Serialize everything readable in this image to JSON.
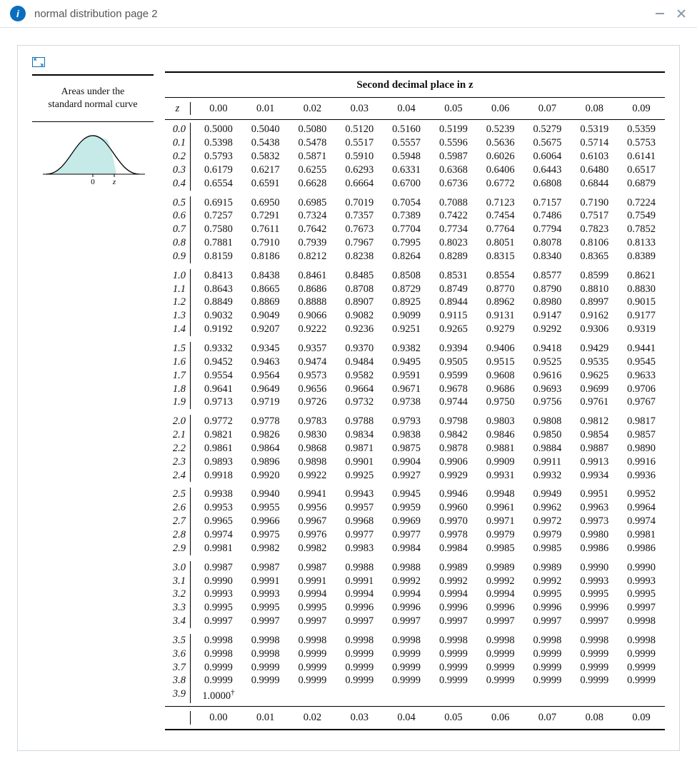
{
  "header": {
    "title": "normal distribution page 2"
  },
  "panel": {
    "side_label_line1": "Areas under the",
    "side_label_line2": "standard normal curve",
    "table_title": "Second decimal place in z",
    "z_header": "z"
  },
  "chart_data": {
    "type": "table",
    "title": "Areas under the standard normal curve — Second decimal place in z",
    "columns": [
      "0.00",
      "0.01",
      "0.02",
      "0.03",
      "0.04",
      "0.05",
      "0.06",
      "0.07",
      "0.08",
      "0.09"
    ],
    "footer_columns": [
      "0.00",
      "0.01",
      "0.02",
      "0.03",
      "0.04",
      "0.05",
      "0.06",
      "0.07",
      "0.08",
      "0.09"
    ],
    "row_groups": [
      [
        {
          "z": "0.0",
          "v": [
            "0.5000",
            "0.5040",
            "0.5080",
            "0.5120",
            "0.5160",
            "0.5199",
            "0.5239",
            "0.5279",
            "0.5319",
            "0.5359"
          ]
        },
        {
          "z": "0.1",
          "v": [
            "0.5398",
            "0.5438",
            "0.5478",
            "0.5517",
            "0.5557",
            "0.5596",
            "0.5636",
            "0.5675",
            "0.5714",
            "0.5753"
          ]
        },
        {
          "z": "0.2",
          "v": [
            "0.5793",
            "0.5832",
            "0.5871",
            "0.5910",
            "0.5948",
            "0.5987",
            "0.6026",
            "0.6064",
            "0.6103",
            "0.6141"
          ]
        },
        {
          "z": "0.3",
          "v": [
            "0.6179",
            "0.6217",
            "0.6255",
            "0.6293",
            "0.6331",
            "0.6368",
            "0.6406",
            "0.6443",
            "0.6480",
            "0.6517"
          ]
        },
        {
          "z": "0.4",
          "v": [
            "0.6554",
            "0.6591",
            "0.6628",
            "0.6664",
            "0.6700",
            "0.6736",
            "0.6772",
            "0.6808",
            "0.6844",
            "0.6879"
          ]
        }
      ],
      [
        {
          "z": "0.5",
          "v": [
            "0.6915",
            "0.6950",
            "0.6985",
            "0.7019",
            "0.7054",
            "0.7088",
            "0.7123",
            "0.7157",
            "0.7190",
            "0.7224"
          ]
        },
        {
          "z": "0.6",
          "v": [
            "0.7257",
            "0.7291",
            "0.7324",
            "0.7357",
            "0.7389",
            "0.7422",
            "0.7454",
            "0.7486",
            "0.7517",
            "0.7549"
          ]
        },
        {
          "z": "0.7",
          "v": [
            "0.7580",
            "0.7611",
            "0.7642",
            "0.7673",
            "0.7704",
            "0.7734",
            "0.7764",
            "0.7794",
            "0.7823",
            "0.7852"
          ]
        },
        {
          "z": "0.8",
          "v": [
            "0.7881",
            "0.7910",
            "0.7939",
            "0.7967",
            "0.7995",
            "0.8023",
            "0.8051",
            "0.8078",
            "0.8106",
            "0.8133"
          ]
        },
        {
          "z": "0.9",
          "v": [
            "0.8159",
            "0.8186",
            "0.8212",
            "0.8238",
            "0.8264",
            "0.8289",
            "0.8315",
            "0.8340",
            "0.8365",
            "0.8389"
          ]
        }
      ],
      [
        {
          "z": "1.0",
          "v": [
            "0.8413",
            "0.8438",
            "0.8461",
            "0.8485",
            "0.8508",
            "0.8531",
            "0.8554",
            "0.8577",
            "0.8599",
            "0.8621"
          ]
        },
        {
          "z": "1.1",
          "v": [
            "0.8643",
            "0.8665",
            "0.8686",
            "0.8708",
            "0.8729",
            "0.8749",
            "0.8770",
            "0.8790",
            "0.8810",
            "0.8830"
          ]
        },
        {
          "z": "1.2",
          "v": [
            "0.8849",
            "0.8869",
            "0.8888",
            "0.8907",
            "0.8925",
            "0.8944",
            "0.8962",
            "0.8980",
            "0.8997",
            "0.9015"
          ]
        },
        {
          "z": "1.3",
          "v": [
            "0.9032",
            "0.9049",
            "0.9066",
            "0.9082",
            "0.9099",
            "0.9115",
            "0.9131",
            "0.9147",
            "0.9162",
            "0.9177"
          ]
        },
        {
          "z": "1.4",
          "v": [
            "0.9192",
            "0.9207",
            "0.9222",
            "0.9236",
            "0.9251",
            "0.9265",
            "0.9279",
            "0.9292",
            "0.9306",
            "0.9319"
          ]
        }
      ],
      [
        {
          "z": "1.5",
          "v": [
            "0.9332",
            "0.9345",
            "0.9357",
            "0.9370",
            "0.9382",
            "0.9394",
            "0.9406",
            "0.9418",
            "0.9429",
            "0.9441"
          ]
        },
        {
          "z": "1.6",
          "v": [
            "0.9452",
            "0.9463",
            "0.9474",
            "0.9484",
            "0.9495",
            "0.9505",
            "0.9515",
            "0.9525",
            "0.9535",
            "0.9545"
          ]
        },
        {
          "z": "1.7",
          "v": [
            "0.9554",
            "0.9564",
            "0.9573",
            "0.9582",
            "0.9591",
            "0.9599",
            "0.9608",
            "0.9616",
            "0.9625",
            "0.9633"
          ]
        },
        {
          "z": "1.8",
          "v": [
            "0.9641",
            "0.9649",
            "0.9656",
            "0.9664",
            "0.9671",
            "0.9678",
            "0.9686",
            "0.9693",
            "0.9699",
            "0.9706"
          ]
        },
        {
          "z": "1.9",
          "v": [
            "0.9713",
            "0.9719",
            "0.9726",
            "0.9732",
            "0.9738",
            "0.9744",
            "0.9750",
            "0.9756",
            "0.9761",
            "0.9767"
          ]
        }
      ],
      [
        {
          "z": "2.0",
          "v": [
            "0.9772",
            "0.9778",
            "0.9783",
            "0.9788",
            "0.9793",
            "0.9798",
            "0.9803",
            "0.9808",
            "0.9812",
            "0.9817"
          ]
        },
        {
          "z": "2.1",
          "v": [
            "0.9821",
            "0.9826",
            "0.9830",
            "0.9834",
            "0.9838",
            "0.9842",
            "0.9846",
            "0.9850",
            "0.9854",
            "0.9857"
          ]
        },
        {
          "z": "2.2",
          "v": [
            "0.9861",
            "0.9864",
            "0.9868",
            "0.9871",
            "0.9875",
            "0.9878",
            "0.9881",
            "0.9884",
            "0.9887",
            "0.9890"
          ]
        },
        {
          "z": "2.3",
          "v": [
            "0.9893",
            "0.9896",
            "0.9898",
            "0.9901",
            "0.9904",
            "0.9906",
            "0.9909",
            "0.9911",
            "0.9913",
            "0.9916"
          ]
        },
        {
          "z": "2.4",
          "v": [
            "0.9918",
            "0.9920",
            "0.9922",
            "0.9925",
            "0.9927",
            "0.9929",
            "0.9931",
            "0.9932",
            "0.9934",
            "0.9936"
          ]
        }
      ],
      [
        {
          "z": "2.5",
          "v": [
            "0.9938",
            "0.9940",
            "0.9941",
            "0.9943",
            "0.9945",
            "0.9946",
            "0.9948",
            "0.9949",
            "0.9951",
            "0.9952"
          ]
        },
        {
          "z": "2.6",
          "v": [
            "0.9953",
            "0.9955",
            "0.9956",
            "0.9957",
            "0.9959",
            "0.9960",
            "0.9961",
            "0.9962",
            "0.9963",
            "0.9964"
          ]
        },
        {
          "z": "2.7",
          "v": [
            "0.9965",
            "0.9966",
            "0.9967",
            "0.9968",
            "0.9969",
            "0.9970",
            "0.9971",
            "0.9972",
            "0.9973",
            "0.9974"
          ]
        },
        {
          "z": "2.8",
          "v": [
            "0.9974",
            "0.9975",
            "0.9976",
            "0.9977",
            "0.9977",
            "0.9978",
            "0.9979",
            "0.9979",
            "0.9980",
            "0.9981"
          ]
        },
        {
          "z": "2.9",
          "v": [
            "0.9981",
            "0.9982",
            "0.9982",
            "0.9983",
            "0.9984",
            "0.9984",
            "0.9985",
            "0.9985",
            "0.9986",
            "0.9986"
          ]
        }
      ],
      [
        {
          "z": "3.0",
          "v": [
            "0.9987",
            "0.9987",
            "0.9987",
            "0.9988",
            "0.9988",
            "0.9989",
            "0.9989",
            "0.9989",
            "0.9990",
            "0.9990"
          ]
        },
        {
          "z": "3.1",
          "v": [
            "0.9990",
            "0.9991",
            "0.9991",
            "0.9991",
            "0.9992",
            "0.9992",
            "0.9992",
            "0.9992",
            "0.9993",
            "0.9993"
          ]
        },
        {
          "z": "3.2",
          "v": [
            "0.9993",
            "0.9993",
            "0.9994",
            "0.9994",
            "0.9994",
            "0.9994",
            "0.9994",
            "0.9995",
            "0.9995",
            "0.9995"
          ]
        },
        {
          "z": "3.3",
          "v": [
            "0.9995",
            "0.9995",
            "0.9995",
            "0.9996",
            "0.9996",
            "0.9996",
            "0.9996",
            "0.9996",
            "0.9996",
            "0.9997"
          ]
        },
        {
          "z": "3.4",
          "v": [
            "0.9997",
            "0.9997",
            "0.9997",
            "0.9997",
            "0.9997",
            "0.9997",
            "0.9997",
            "0.9997",
            "0.9997",
            "0.9998"
          ]
        }
      ],
      [
        {
          "z": "3.5",
          "v": [
            "0.9998",
            "0.9998",
            "0.9998",
            "0.9998",
            "0.9998",
            "0.9998",
            "0.9998",
            "0.9998",
            "0.9998",
            "0.9998"
          ]
        },
        {
          "z": "3.6",
          "v": [
            "0.9998",
            "0.9998",
            "0.9999",
            "0.9999",
            "0.9999",
            "0.9999",
            "0.9999",
            "0.9999",
            "0.9999",
            "0.9999"
          ]
        },
        {
          "z": "3.7",
          "v": [
            "0.9999",
            "0.9999",
            "0.9999",
            "0.9999",
            "0.9999",
            "0.9999",
            "0.9999",
            "0.9999",
            "0.9999",
            "0.9999"
          ]
        },
        {
          "z": "3.8",
          "v": [
            "0.9999",
            "0.9999",
            "0.9999",
            "0.9999",
            "0.9999",
            "0.9999",
            "0.9999",
            "0.9999",
            "0.9999",
            "0.9999"
          ]
        },
        {
          "z": "3.9",
          "v": [
            "1.0000†",
            "",
            "",
            "",
            "",
            "",
            "",
            "",
            "",
            ""
          ]
        }
      ]
    ],
    "axis_labels": {
      "x0": "0",
      "xz": "z"
    }
  }
}
